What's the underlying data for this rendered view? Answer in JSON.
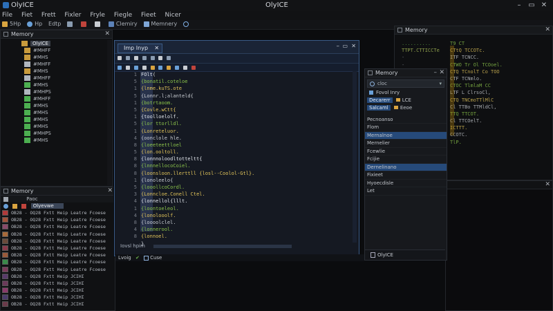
{
  "app": {
    "name": "OlyICE",
    "window_title": "OlyICE"
  },
  "menu": [
    "File",
    "Fiet",
    "Frett",
    "Fixler",
    "Fryle",
    "Fiegle",
    "Fieet",
    "Nicer"
  ],
  "toolbar": [
    {
      "icon": "save-icon",
      "label": "5Hp"
    },
    {
      "icon": "run-icon",
      "label": "Hp"
    },
    {
      "icon": "edit-icon",
      "label": "Edtp"
    },
    {
      "icon": "break-icon",
      "label": ""
    },
    {
      "icon": "view-icon",
      "label": ""
    },
    {
      "icon": "memory-icon",
      "label": "Clemiry"
    },
    {
      "icon": "mem2-icon",
      "label": "Memnery"
    },
    {
      "icon": "search-icon",
      "label": ""
    }
  ],
  "left_panel": {
    "title": "Memory",
    "root": "OlyICE",
    "items": [
      "#MHFF",
      "#MHS",
      "#MHFF",
      "#MHS",
      "#MHFF",
      "#MHS",
      "#MHPS",
      "#MHFF",
      "#MHS",
      "#MHS",
      "#MHS",
      "#MHS",
      "#MHPS",
      "#MHS"
    ]
  },
  "bottom_panel": {
    "title": "Memory",
    "filter": "Paoc",
    "selected": "Olyevwe",
    "rows": [
      "OB28 - OQ28 Fxtt Heip Leatre Fcoese",
      "OB28 - OQ28 Fxtt Heip Leatre Fcoese",
      "OB28 - OQ28 Fxtt Heip Leatre Fcoese",
      "OB28 - OQ28 Fxtt Heip Leatre Fcoese",
      "OB28 - OQ28 Fxtt Heip Leatre Fcoese",
      "OB28 - OQ28 Fxtt Heip Leatre Fcoese",
      "OB28 - OQ28 Fxtt Heip Leatre Fcoese",
      "OB28 - OQ28 Fxtt Heip Leatre Fcoese",
      "OB28 - OQ28 Fxtt Heip Leatre Fcoese",
      "OB28 - OQ28 Fxtt Heip JCIHI",
      "OB28 - OQ28 Fxtt Heip JCIHI",
      "OB28 - OQ28 Fxtt Heip JCIHI",
      "OB28 - OQ28 Fxtt Heip JCIHI",
      "OB28 - OQ28 Fxtt Heip JCIHI"
    ],
    "row_colors": [
      "#b03a3a",
      "#a0523a",
      "#8a4a6a",
      "#a86a3a",
      "#6a4a3a",
      "#8a3a4a",
      "#9a5a3a",
      "#3a8a4a",
      "#7a3a5a",
      "#5a3a6a",
      "#6a3a5a",
      "#8a3a6a",
      "#4a3a6a",
      "#6a3a4a"
    ]
  },
  "editor": {
    "tab_title": "Imp Inyp",
    "status_left": "Iovsl hpim",
    "status_mid": "Lvoig",
    "status_btn": "Cuse",
    "line_numbers": [
      "1",
      "5",
      "1",
      "5",
      "1",
      "5",
      "1",
      "5",
      "1",
      "4",
      "8",
      "5",
      "8",
      "8",
      "8",
      "1",
      "5",
      "3",
      "4",
      "1",
      "4",
      "8",
      "4",
      "8"
    ],
    "code": [
      "FOlt(",
      "  {bonatil.coteloe",
      "  {lnme.kuTS.ote",
      "  {Lonnr.l;alanteld{",
      "  {botrtaoom.",
      "  {Covle.wCtt{",
      "  {toolloelolf.",
      "  {lor  ttorlldl.",
      "  {Lonreteluor.",
      "  {oonclole hle.",
      "  {loeeteettloel",
      "  {lon.ooltoll.",
      "  {lonnnoloodltotteltt{",
      "  {lnnnellocoCoiel.",
      "  {loonsloon.llerttll   {losl--Coolol-Gtl}.",
      "  {lonoleelo{",
      "  {looollcoCordl.",
      "  {Lonncloe.Conell Ctel.",
      "  {lonnellol{lllt.",
      "  {loontoeleol.",
      "  {lonolooolf.",
      "  {loooolclel.",
      "  {lonnerool.",
      "   {lonnoel.",
      "  }"
    ]
  },
  "properties": {
    "title": "Memory",
    "search_value": "cloc",
    "group_label": "Fovol Inry",
    "combo1": "Decarerr",
    "combo2": "Salcaml",
    "combo1_value": "LCE",
    "combo2_value": "Eeoe",
    "rows": [
      "Pecnoanso",
      "Flom",
      "Mernalnoe",
      "Mernelier",
      "Fcewlie",
      "Fcijie",
      "Dernelinano",
      "Fixieet",
      "Hyoecdisle",
      "Let"
    ],
    "selected_rows": [
      2,
      6
    ],
    "footer": "OlyICE"
  },
  "memory_tr": {
    "title": "Memory",
    "left_lines": [
      "..........",
      "TTPT.CTTICCTe",
      "-",
      "-",
      "-"
    ],
    "right_lines": [
      "T9 CT",
      "  CTtQ  TCCOTc.",
      "  ITF  TCNCC.",
      "  CTWO  Tr Ol  TCOoel.",
      "  CTQ  TCnolT  Co  TOO",
      "  CTF  TCNmlo.",
      "  CTOC  TlmlaM  CC",
      "  LTF  L  ClrsoCl,",
      "  CTQ  TNCmoTTlMlC",
      "  Cl  TTBo  TTMldCl,",
      "  TTQ  TTCOT.",
      "  Cl  TTCOelT.",
      "   ICTTT.",
      "  CCOTC.",
      "   TlP."
    ]
  },
  "colors": {
    "accent": "#2c6fb8",
    "selected": "#264a7a",
    "code_green": "#8bc34a",
    "code_yellow": "#e0c35a"
  }
}
